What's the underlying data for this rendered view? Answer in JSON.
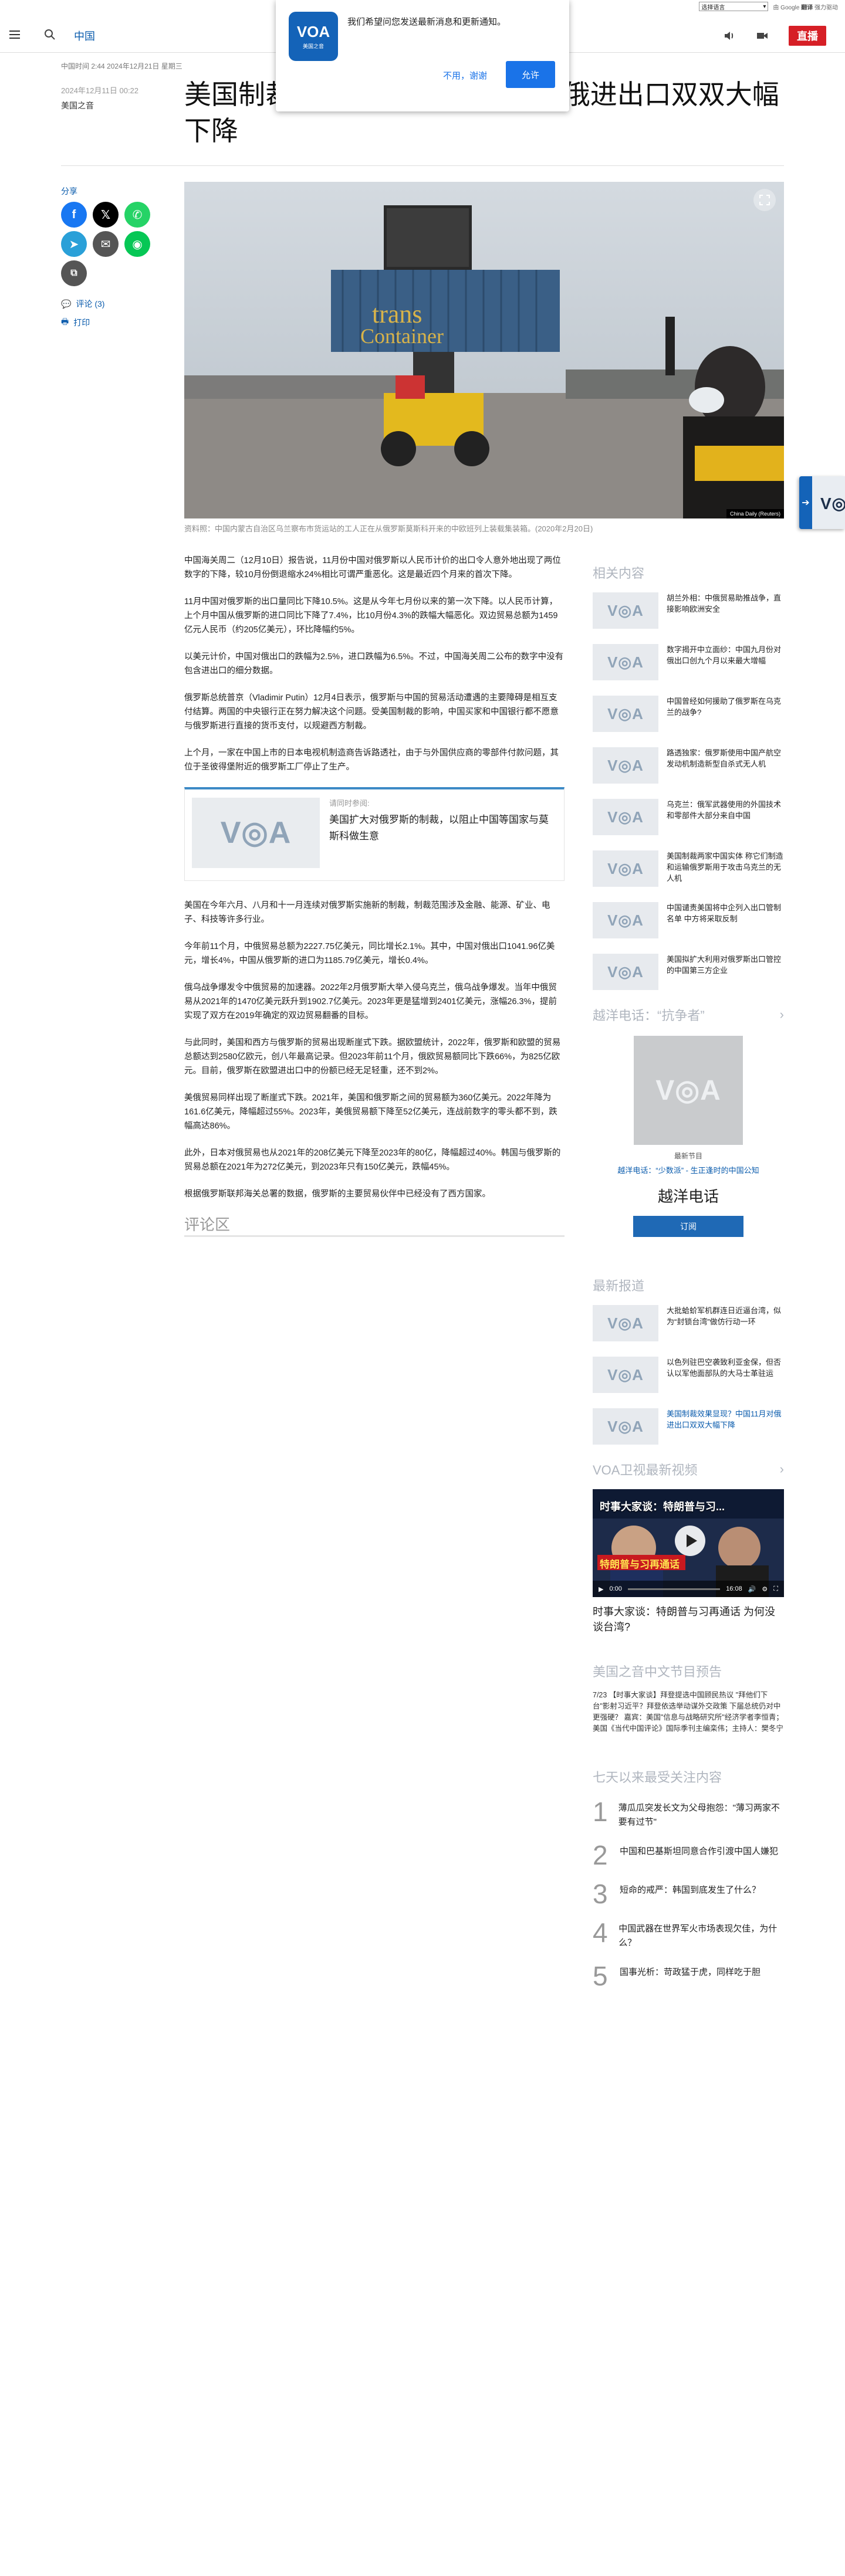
{
  "translate_bar": {
    "select_label": "选择语言",
    "powered_by": "由 Google",
    "brand": "翻译",
    "provided": "强力驱动"
  },
  "header": {
    "section": "中国",
    "live_label": "直播"
  },
  "notification": {
    "logo_main": "VOA",
    "logo_sub": "美国之音",
    "message": "我们希望问您发送最新消息和更新通知。",
    "deny_label": "不用，谢谢",
    "allow_label": "允许"
  },
  "article": {
    "meta_line": "中国时间 2:44 2024年12月21日 星期三",
    "date": "2024年12月11日 00:22",
    "author": "美国之音",
    "title": "美国制裁效果显现？中国11月对俄进出口双双大幅下降",
    "image_credit": "China Daily (Reuters)",
    "caption": "资料照：中国内蒙古自治区乌兰察布市货运站的工人正在从俄罗斯莫斯科开来的中欧班列上装载集装箱。(2020年2月20日)",
    "paragraphs": [
      "中国海关周二（12月10日）报告说，11月份中国对俄罗斯以人民币计价的出口令人意外地出现了两位数字的下降，较10月份倒退缩水24%相比可谓严重恶化。这是最近四个月来的首次下降。",
      "11月中国对俄罗斯的出口量同比下降10.5%。这是从今年七月份以来的第一次下降。以人民币计算，上个月中国从俄罗斯的进口同比下降了7.4%，比10月份4.3%的跌幅大幅恶化。双边贸易总额为1459亿元人民币（约205亿美元），环比降幅约5%。",
      "以美元计价，中国对俄出口的跌幅为2.5%，进口跌幅为6.5%。不过，中国海关周二公布的数字中没有包含进出口的细分数据。",
      "俄罗斯总统普京（Vladimir Putin）12月4日表示，俄罗斯与中国的贸易活动遭遇的主要障碍是相互支付结算。两国的中央银行正在努力解决这个问题。受美国制裁的影响，中国买家和中国银行都不愿意与俄罗斯进行直接的货币支付，以规避西方制裁。",
      "上个月，一家在中国上市的日本电视机制造商告诉路透社，由于与外国供应商的零部件付款问题，其位于圣彼得堡附近的俄罗斯工厂停止了生产。"
    ],
    "related": {
      "kicker": "请同时参阅:",
      "title": "美国扩大对俄罗斯的制裁，以阻止中国等国家与莫斯科做生意"
    },
    "paragraphs2": [
      "美国在今年六月、八月和十一月连续对俄罗斯实施新的制裁，制裁范围涉及金融、能源、矿业、电子、科技等许多行业。",
      "今年前11个月，中俄贸易总额为2227.75亿美元，同比增长2.1%。其中，中国对俄出口1041.96亿美元，增长4%，中国从俄罗斯的进口为1185.79亿美元，增长0.4%。",
      "俄乌战争爆发令中俄贸易的加速器。2022年2月俄罗斯大举入侵乌克兰，俄乌战争爆发。当年中俄贸易从2021年的1470亿美元跃升到1902.7亿美元。2023年更是猛增到2401亿美元，涨幅26.3%，提前实现了双方在2019年确定的双边贸易翻番的目标。",
      "与此同时，美国和西方与俄罗斯的贸易出现断崖式下跌。据欧盟统计，2022年，俄罗斯和欧盟的贸易总额达到2580亿欧元，创八年最高记录。但2023年前11个月，俄欧贸易额同比下跌66%，为825亿欧元。目前，俄罗斯在欧盟进出口中的份额已经无足轻重，还不到2%。",
      "美俄贸易同样出现了断崖式下跌。2021年，美国和俄罗斯之间的贸易额为360亿美元。2022年降为161.6亿美元，降幅超过55%。2023年，美俄贸易额下降至52亿美元，连战前数字的零头都不到，跌幅高达86%。",
      "此外，日本对俄贸易也从2021年的208亿美元下降至2023年的80亿，降幅超过40%。韩国与俄罗斯的贸易总额在2021年为272亿美元，到2023年只有150亿美元，跌幅45%。",
      "根据俄罗斯联邦海关总署的数据，俄罗斯的主要贸易伙伴中已经没有了西方国家。"
    ],
    "comments_heading": "评论区"
  },
  "share": {
    "label": "分享",
    "comments": "评论 (3)",
    "print": "打印"
  },
  "sidebar": {
    "related_heading": "相关内容",
    "related": [
      "胡兰外相：中俄贸易助推战争，直接影响欧洲安全",
      "数字揭开中立面纱：中国九月份对俄出口创九个月以来最大增幅",
      "中国曾经如何援助了俄罗斯在乌克兰的战争?",
      "路透独家：俄罗斯使用中国产航空发动机制造新型自杀式无人机",
      "乌克兰：俄军武器使用的外国技术和零部件大部分来自中国",
      "美国制裁两家中国实体 称它们制造和运输俄罗斯用于攻击乌克兰的无人机",
      "中国谴责美国将中企列入出口管制名单 中方将采取反制",
      "美国拟扩大利用对俄罗斯出口管控的中国第三方企业"
    ],
    "podcast_heading": "越洋电话：“抗争者”",
    "podcast_kicker": "最新节目",
    "podcast_link": "越洋电话：“少数派” - 生正逢时的中国公知",
    "podcast_title": "越洋电话",
    "subscribe_label": "订阅",
    "latest_heading": "最新报道",
    "latest": [
      "大批蛤蚧军机群连日近逼台湾，似为“封锁台湾”做仿行动一环",
      "以色列驻巴空袭致利亚金保，但否认以军他面部队的大马士革驻运",
      "美国制裁效果显现？中国11月对俄进出口双双大幅下降"
    ],
    "video_heading": "VOA卫视最新视频",
    "video_overlay": "时事大家谈：特朗普与习...",
    "video_banner": "特朗普与习再通话",
    "video_time_current": "0:00",
    "video_time_total": "16:08",
    "video_caption": "时事大家谈：特朗普与习再通话 为何没谈台湾?",
    "schedule_heading": "美国之音中文节目预告",
    "schedule_text": "7/23 【时事大家谈】拜登提选中国顾民热议 \"拜他们下台\"影射习近平？拜登依选举动谋外交政策 下届总统仍对中更强硬？ 嘉宾：美国\"信息与战略研究所\"经济学者李恒青；美国《当代中国评论》国际季刊主编栾伟；主持人：樊冬宁",
    "popular_heading": "七天以来最受关注内容",
    "popular": [
      {
        "n": "1",
        "t": "薄瓜瓜突发长文为父母抱怨：\"薄习两家不要有过节\""
      },
      {
        "n": "2",
        "t": "中国和巴基斯坦同意合作引渡中国人嫌犯"
      },
      {
        "n": "3",
        "t": "短命的戒严：韩国到底发生了什么？"
      },
      {
        "n": "4",
        "t": "中国武器在世界军火市场表现欠佳，为什么？"
      },
      {
        "n": "5",
        "t": "国事光析：苛政猛于虎，同样吃于胆"
      }
    ]
  },
  "colors": {
    "brand_blue": "#1463b8",
    "live_red": "#d61f26",
    "link_blue": "#0b5cad"
  }
}
